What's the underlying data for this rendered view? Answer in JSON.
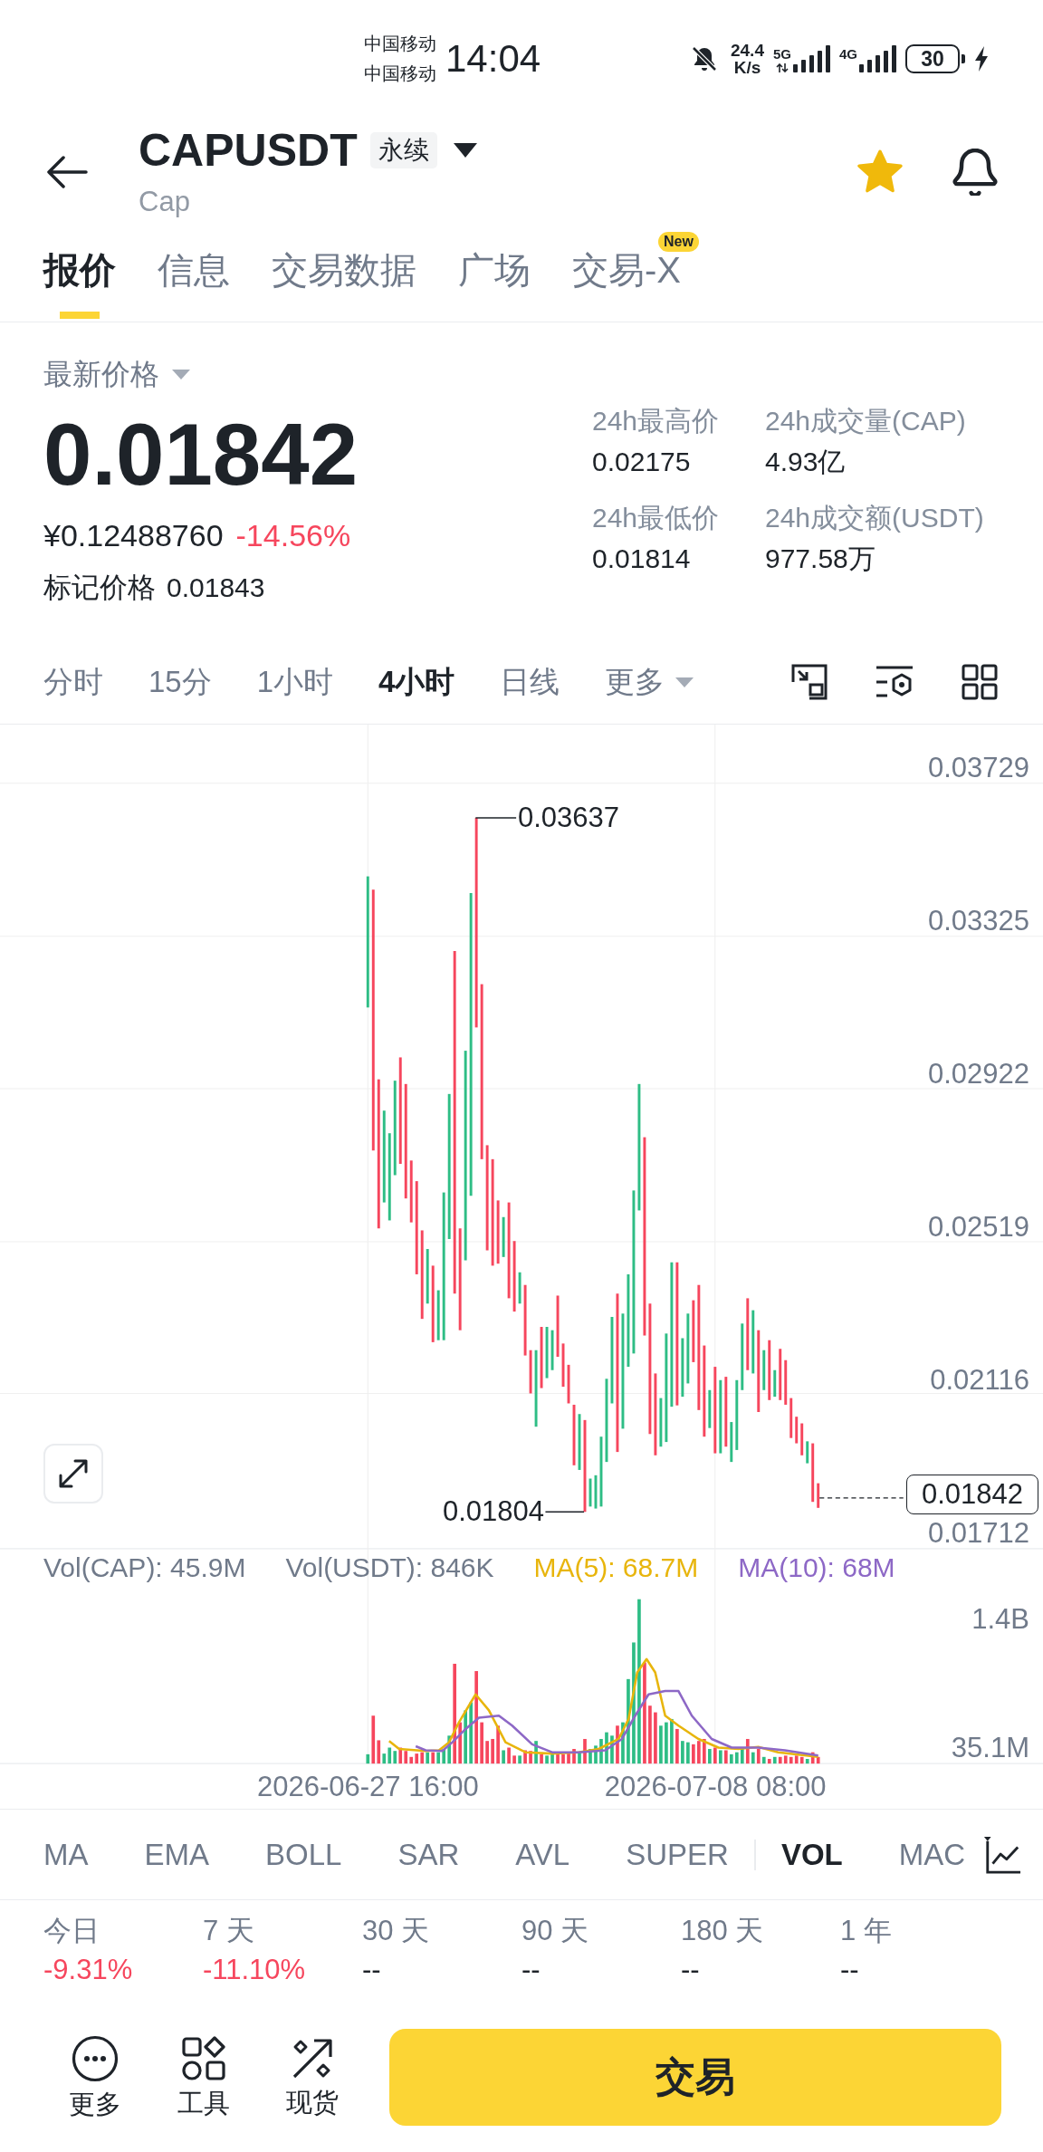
{
  "status_bar": {
    "carriers": [
      "中国移动",
      "中国移动"
    ],
    "time": "14:04",
    "net_speed": "24.4",
    "net_speed_unit": "K/s",
    "networks": [
      {
        "label": "5G",
        "data_active": true
      },
      {
        "label": "4G",
        "data_active": false
      }
    ],
    "battery": "30",
    "charging": true
  },
  "header": {
    "symbol": "CAPUSDT",
    "contract_type": "永续",
    "name": "Cap",
    "favorite": true
  },
  "tabs": [
    {
      "label": "报价",
      "selected": true
    },
    {
      "label": "信息",
      "selected": false
    },
    {
      "label": "交易数据",
      "selected": false
    },
    {
      "label": "广场",
      "selected": false
    },
    {
      "label": "交易-X",
      "selected": false,
      "badge": "New"
    }
  ],
  "price": {
    "label": "最新价格",
    "last": "0.01842",
    "fiat": "¥0.12488760",
    "change": "-14.56%",
    "negative": true,
    "mark_label": "标记价格",
    "mark": "0.01843"
  },
  "stats": [
    {
      "label": "24h最高价",
      "value": "0.02175"
    },
    {
      "label": "24h成交量(CAP)",
      "value": "4.93亿"
    },
    {
      "label": "24h最低价",
      "value": "0.01814"
    },
    {
      "label": "24h成交额(USDT)",
      "value": "977.58万"
    }
  ],
  "intervals": [
    {
      "label": "分时",
      "selected": false,
      "kind": "option"
    },
    {
      "label": "15分",
      "selected": false,
      "kind": "option"
    },
    {
      "label": "1小时",
      "selected": false,
      "kind": "option"
    },
    {
      "label": "4小时",
      "selected": true,
      "kind": "option"
    },
    {
      "label": "日线",
      "selected": false,
      "kind": "option"
    },
    {
      "label": "更多",
      "selected": false,
      "kind": "menu"
    }
  ],
  "chart": {
    "price_ticks": [
      "0.03729",
      "0.03325",
      "0.02922",
      "0.02519",
      "0.02116",
      "0.01712"
    ],
    "high": "0.03637",
    "low": "0.01804",
    "last": "0.01842"
  },
  "volume": {
    "legend": [
      {
        "text": "Vol(CAP): 45.9M",
        "color": "#707a8a"
      },
      {
        "text": "Vol(USDT): 846K",
        "color": "#707a8a"
      },
      {
        "text": "MA(5): 68.7M",
        "color": "#e8b50c"
      },
      {
        "text": "MA(10): 68M",
        "color": "#8d68c6"
      }
    ],
    "ticks": [
      "1.4B",
      "35.1M"
    ]
  },
  "time_axis": [
    "2026-06-27 16:00",
    "2026-07-08 08:00"
  ],
  "main_indicators": [
    {
      "label": "MA",
      "selected": false
    },
    {
      "label": "EMA",
      "selected": false
    },
    {
      "label": "BOLL",
      "selected": false
    },
    {
      "label": "SAR",
      "selected": false
    },
    {
      "label": "AVL",
      "selected": false
    },
    {
      "label": "SUPER",
      "selected": false
    }
  ],
  "sub_indicators": [
    {
      "label": "VOL",
      "selected": true
    },
    {
      "label": "MAC",
      "selected": false
    }
  ],
  "returns": [
    {
      "period": "今日",
      "value": "-9.31%",
      "negative": true
    },
    {
      "period": "7 天",
      "value": "-11.10%",
      "negative": true
    },
    {
      "period": "30 天",
      "value": "--",
      "negative": false
    },
    {
      "period": "90 天",
      "value": "--",
      "negative": false
    },
    {
      "period": "180 天",
      "value": "--",
      "negative": false
    },
    {
      "period": "1 年",
      "value": "--",
      "negative": false
    }
  ],
  "bottom_bar": {
    "actions": [
      {
        "label": "更多",
        "kind": "more"
      },
      {
        "label": "工具",
        "kind": "tools"
      },
      {
        "label": "现货",
        "kind": "spot"
      }
    ],
    "trade_button": "交易"
  }
}
